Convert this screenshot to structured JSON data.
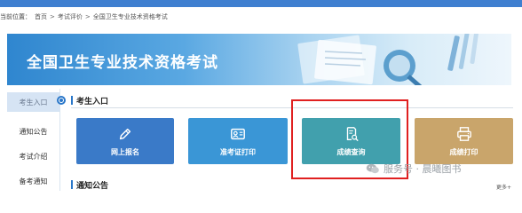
{
  "breadcrumb": {
    "prefix": "当前位置：",
    "items": [
      "首页",
      "考试评价",
      "全国卫生专业技术资格考试"
    ],
    "separator": ">"
  },
  "banner": {
    "title": "全国卫生专业技术资格考试"
  },
  "sidebar": {
    "items": [
      {
        "label": "考生入口",
        "active": true
      },
      {
        "label": "通知公告",
        "active": false
      },
      {
        "label": "考试介绍",
        "active": false
      },
      {
        "label": "备考通知",
        "active": false
      }
    ]
  },
  "sections": {
    "entrance_title": "考生入口",
    "notices_title": "通知公告",
    "more_label": "更多+"
  },
  "tiles": [
    {
      "label": "网上报名",
      "icon": "pen-icon",
      "color": "#3a7ac8"
    },
    {
      "label": "准考证打印",
      "icon": "id-card-icon",
      "color": "#3a96d6"
    },
    {
      "label": "成绩查询",
      "icon": "document-search-icon",
      "color": "#41a0ad"
    },
    {
      "label": "成绩打印",
      "icon": "printer-icon",
      "color": "#c9a56b"
    }
  ],
  "highlight": {
    "target": "成绩查询",
    "color": "#e02020"
  },
  "watermark": {
    "text": "服务号 · 晨曦图书"
  },
  "colors": {
    "top_bar": "#3f7fd0",
    "accent": "#2a77c9"
  }
}
